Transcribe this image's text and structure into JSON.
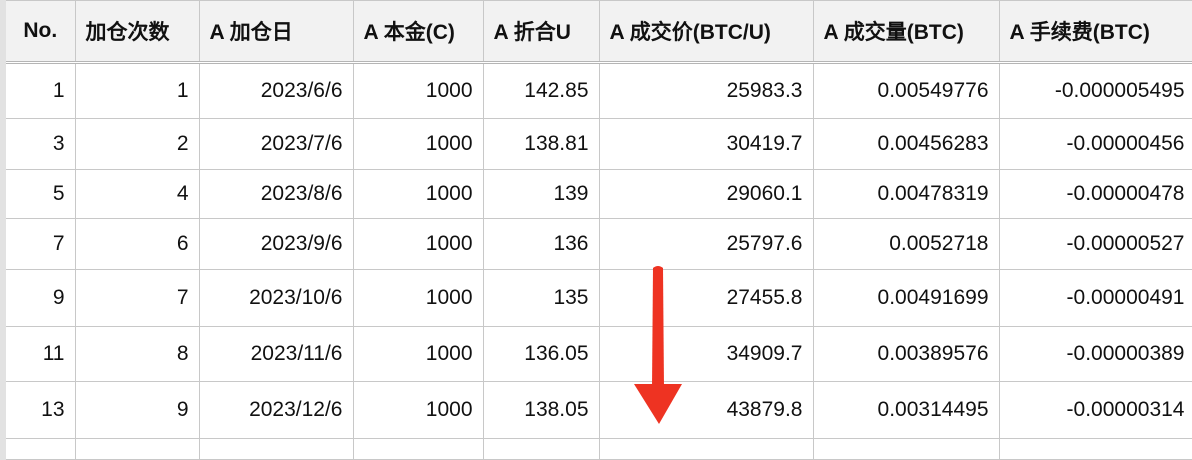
{
  "table": {
    "headers": [
      "No.",
      "加仓次数",
      "A 加仓日",
      "A 本金(C)",
      "A 折合U",
      "A 成交价(BTC/U)",
      "A 成交量(BTC)",
      "A 手续费(BTC)"
    ],
    "rows": [
      [
        "1",
        "1",
        "2023/6/6",
        "1000",
        "142.85",
        "25983.3",
        "0.00549776",
        "-0.000005495"
      ],
      [
        "3",
        "2",
        "2023/7/6",
        "1000",
        "138.81",
        "30419.7",
        "0.00456283",
        "-0.00000456"
      ],
      [
        "5",
        "4",
        "2023/8/6",
        "1000",
        "139",
        "29060.1",
        "0.00478319",
        "-0.00000478"
      ],
      [
        "7",
        "6",
        "2023/9/6",
        "1000",
        "136",
        "25797.6",
        "0.0052718",
        "-0.00000527"
      ],
      [
        "9",
        "7",
        "2023/10/6",
        "1000",
        "135",
        "27455.8",
        "0.00491699",
        "-0.00000491"
      ],
      [
        "11",
        "8",
        "2023/11/6",
        "1000",
        "136.05",
        "34909.7",
        "0.00389576",
        "-0.00000389"
      ],
      [
        "13",
        "9",
        "2023/12/6",
        "1000",
        "138.05",
        "43879.8",
        "0.00314495",
        "-0.00000314"
      ]
    ]
  },
  "annotation": {
    "arrow_color": "#ee3322",
    "arrow_direction": "down"
  }
}
